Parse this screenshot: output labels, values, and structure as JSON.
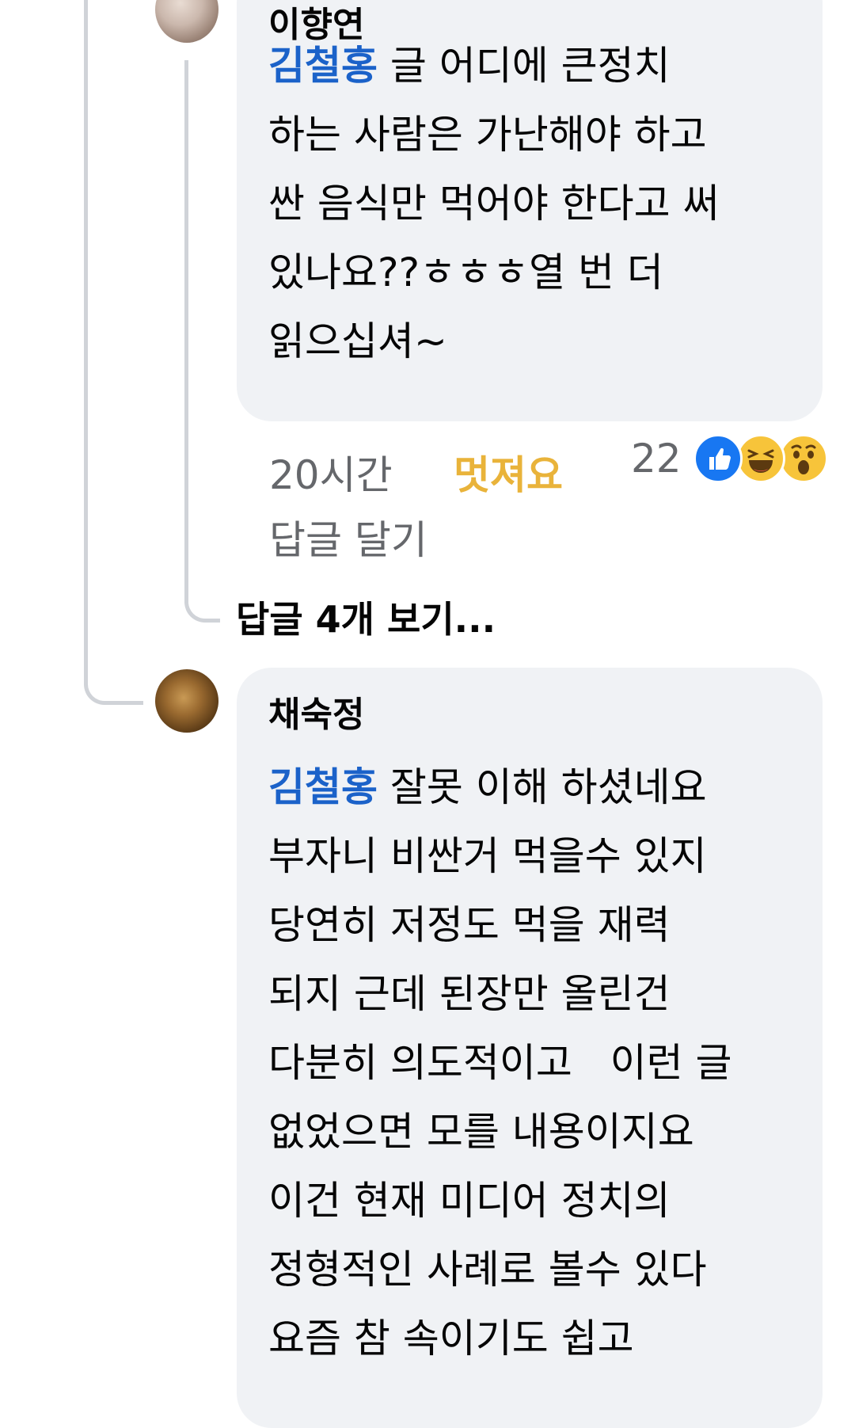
{
  "comment1": {
    "author": "이향연",
    "mention": "김철홍",
    "body_lines": [
      " 글 어디에 큰정치",
      "하는 사람은 가난해야 하고",
      "싼 음식만 먹어야 한다고 써",
      "있나요??ㅎㅎㅎ열 번 더",
      "읽으십셔~"
    ],
    "time": "20시간",
    "reaction_label": "멋져요",
    "reply_label": "답글 달기",
    "reaction_count": "22",
    "reaction_icons": [
      "like-icon",
      "haha-icon",
      "wow-icon"
    ],
    "colors": {
      "like": "#1877f2",
      "haha": "#f7c43a",
      "reaction_label": "#e9b33a"
    }
  },
  "view_replies": "답글 4개 보기...",
  "comment2": {
    "author": "채숙정",
    "mention": "김철홍",
    "body_lines": [
      " 잘못 이해 하셨네요",
      "부자니 비싼거 먹을수 있지",
      "당연히 저정도 먹을 재력",
      "되지 근데 된장만 올린건",
      "다분히 의도적이고   이런 글",
      "없었으면 모를 내용이지요",
      "이건 현재 미디어 정치의",
      "정형적인 사례로 볼수 있다",
      "요즘 참 속이기도 쉽고"
    ]
  },
  "colors": {
    "mention": "#1b62c9",
    "bubble": "#f0f2f5",
    "muted_text": "#65676b",
    "thread_line": "#d0d3d8"
  }
}
